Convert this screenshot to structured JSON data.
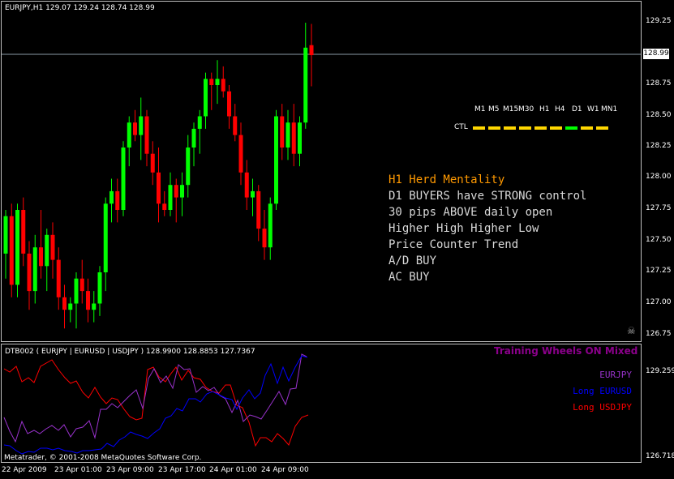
{
  "header": {
    "symbol_info": "EURJPY,H1  129.07 129.24 128.74 128.99",
    "indicator_info": "DTB002 ( EURJPY | EURUSD | USDJPY ) 128.9900 128.8853 127.7367"
  },
  "price_scale": {
    "labels": [
      "129.25",
      "128.99",
      "128.75",
      "128.50",
      "128.25",
      "128.00",
      "127.75",
      "127.50",
      "127.25",
      "127.00",
      "126.75"
    ],
    "current_price": "128.99"
  },
  "indicator_scale": {
    "top": "129.2599",
    "bottom": "126.7181"
  },
  "time_axis": {
    "labels": [
      "22 Apr 2009",
      "23 Apr 01:00",
      "23 Apr 09:00",
      "23 Apr 17:00",
      "24 Apr 01:00",
      "24 Apr 09:00"
    ]
  },
  "timeframes": {
    "labels": [
      "M1",
      "M5",
      "M15",
      "M30",
      "H1",
      "H4",
      "D1",
      "W1",
      "MN1"
    ],
    "ctl_label": "CTL",
    "ctl_colors": [
      "#ffd700",
      "#ffd700",
      "#ffd700",
      "#ffd700",
      "#ffd700",
      "#ffd700",
      "#00ff00",
      "#ffd700",
      "#ffd700"
    ]
  },
  "info_panel": {
    "title": "H1 Herd Mentality",
    "title_color": "#ff9900",
    "lines": [
      "D1 BUYERS have STRONG control",
      "30 pips ABOVE daily open",
      "Higher High  Higher Low",
      "Price Counter Trend",
      "A/D BUY",
      "AC BUY"
    ]
  },
  "indicator_panel": {
    "mode_label": "Training Wheels ON Mixed",
    "mode_color": "#8b008b",
    "series_labels": [
      {
        "text": "EURJPY",
        "color": "#9932cc"
      },
      {
        "text": "Long EURUSD",
        "color": "#0000ff"
      },
      {
        "text": "Long USDJPY",
        "color": "#ff0000"
      }
    ]
  },
  "copyright": "Metatrader, © 2001-2008 MetaQuotes Software Corp.",
  "chart_data": {
    "type": "candlestick",
    "symbol": "EURJPY",
    "timeframe": "H1",
    "ylim": [
      126.7,
      129.3
    ],
    "candles": [
      {
        "o": 127.4,
        "h": 127.75,
        "l": 127.2,
        "c": 127.7
      },
      {
        "o": 127.7,
        "h": 127.8,
        "l": 127.05,
        "c": 127.15
      },
      {
        "o": 127.15,
        "h": 127.8,
        "l": 127.05,
        "c": 127.75
      },
      {
        "o": 127.75,
        "h": 127.85,
        "l": 127.3,
        "c": 127.4
      },
      {
        "o": 127.4,
        "h": 127.5,
        "l": 126.95,
        "c": 127.1
      },
      {
        "o": 127.1,
        "h": 127.55,
        "l": 127.0,
        "c": 127.45
      },
      {
        "o": 127.45,
        "h": 127.75,
        "l": 127.2,
        "c": 127.3
      },
      {
        "o": 127.3,
        "h": 127.6,
        "l": 127.1,
        "c": 127.55
      },
      {
        "o": 127.55,
        "h": 127.65,
        "l": 127.2,
        "c": 127.35
      },
      {
        "o": 127.35,
        "h": 127.45,
        "l": 126.95,
        "c": 127.05
      },
      {
        "o": 127.05,
        "h": 127.15,
        "l": 126.8,
        "c": 126.95
      },
      {
        "o": 126.95,
        "h": 127.05,
        "l": 126.85,
        "c": 127.0
      },
      {
        "o": 127.0,
        "h": 127.25,
        "l": 126.8,
        "c": 127.2
      },
      {
        "o": 127.2,
        "h": 127.35,
        "l": 127.0,
        "c": 127.1
      },
      {
        "o": 127.1,
        "h": 127.2,
        "l": 126.85,
        "c": 126.95
      },
      {
        "o": 126.95,
        "h": 127.1,
        "l": 126.85,
        "c": 127.0
      },
      {
        "o": 127.0,
        "h": 127.3,
        "l": 126.9,
        "c": 127.25
      },
      {
        "o": 127.25,
        "h": 127.85,
        "l": 127.1,
        "c": 127.8
      },
      {
        "o": 127.8,
        "h": 128.0,
        "l": 127.65,
        "c": 127.9
      },
      {
        "o": 127.9,
        "h": 128.0,
        "l": 127.65,
        "c": 127.75
      },
      {
        "o": 127.75,
        "h": 128.3,
        "l": 127.7,
        "c": 128.25
      },
      {
        "o": 128.25,
        "h": 128.5,
        "l": 128.1,
        "c": 128.45
      },
      {
        "o": 128.45,
        "h": 128.55,
        "l": 128.3,
        "c": 128.35
      },
      {
        "o": 128.35,
        "h": 128.65,
        "l": 128.15,
        "c": 128.5
      },
      {
        "o": 128.5,
        "h": 128.55,
        "l": 128.1,
        "c": 128.2
      },
      {
        "o": 128.2,
        "h": 128.3,
        "l": 127.95,
        "c": 128.05
      },
      {
        "o": 128.05,
        "h": 128.25,
        "l": 127.65,
        "c": 127.8
      },
      {
        "o": 127.8,
        "h": 127.9,
        "l": 127.7,
        "c": 127.75
      },
      {
        "o": 127.75,
        "h": 128.05,
        "l": 127.7,
        "c": 127.95
      },
      {
        "o": 127.95,
        "h": 128.0,
        "l": 127.65,
        "c": 127.85
      },
      {
        "o": 127.85,
        "h": 128.05,
        "l": 127.7,
        "c": 127.95
      },
      {
        "o": 127.95,
        "h": 128.35,
        "l": 127.85,
        "c": 128.25
      },
      {
        "o": 128.25,
        "h": 128.45,
        "l": 128.1,
        "c": 128.4
      },
      {
        "o": 128.4,
        "h": 128.55,
        "l": 128.2,
        "c": 128.5
      },
      {
        "o": 128.5,
        "h": 128.85,
        "l": 128.4,
        "c": 128.8
      },
      {
        "o": 128.8,
        "h": 128.85,
        "l": 128.55,
        "c": 128.75
      },
      {
        "o": 128.75,
        "h": 128.95,
        "l": 128.6,
        "c": 128.8
      },
      {
        "o": 128.8,
        "h": 128.9,
        "l": 128.65,
        "c": 128.7
      },
      {
        "o": 128.7,
        "h": 128.75,
        "l": 128.4,
        "c": 128.5
      },
      {
        "o": 128.5,
        "h": 128.6,
        "l": 128.3,
        "c": 128.35
      },
      {
        "o": 128.35,
        "h": 128.45,
        "l": 127.95,
        "c": 128.05
      },
      {
        "o": 128.05,
        "h": 128.15,
        "l": 127.75,
        "c": 127.85
      },
      {
        "o": 127.85,
        "h": 128.0,
        "l": 127.7,
        "c": 127.9
      },
      {
        "o": 127.9,
        "h": 127.95,
        "l": 127.5,
        "c": 127.6
      },
      {
        "o": 127.6,
        "h": 127.75,
        "l": 127.35,
        "c": 127.45
      },
      {
        "o": 127.45,
        "h": 127.85,
        "l": 127.35,
        "c": 127.8
      },
      {
        "o": 127.8,
        "h": 128.55,
        "l": 127.75,
        "c": 128.5
      },
      {
        "o": 128.5,
        "h": 128.6,
        "l": 128.15,
        "c": 128.25
      },
      {
        "o": 128.25,
        "h": 128.55,
        "l": 128.15,
        "c": 128.45
      },
      {
        "o": 128.45,
        "h": 128.6,
        "l": 128.1,
        "c": 128.2
      },
      {
        "o": 128.2,
        "h": 128.5,
        "l": 128.1,
        "c": 128.45
      },
      {
        "o": 128.45,
        "h": 129.25,
        "l": 128.4,
        "c": 129.05
      },
      {
        "o": 129.07,
        "h": 129.24,
        "l": 128.74,
        "c": 128.99
      }
    ]
  }
}
